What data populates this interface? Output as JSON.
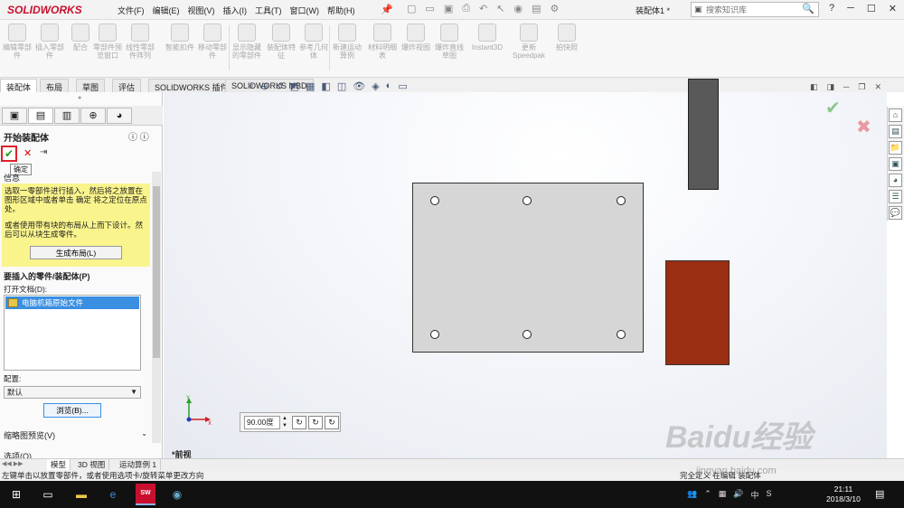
{
  "app": {
    "logo_text": "SOLIDWORKS",
    "menus": [
      "文件(F)",
      "编辑(E)",
      "视图(V)",
      "插入(I)",
      "工具(T)",
      "窗口(W)",
      "帮助(H)"
    ],
    "doc_title": "装配体1 *",
    "search_placeholder": "搜索知识库",
    "window_controls": [
      "?",
      "─",
      "☐",
      "✕"
    ]
  },
  "ribbon": {
    "items": [
      "编辑零部件",
      "插入零部件",
      "配合",
      "零部件预览窗口",
      "线性零部件阵列",
      "智能扣件",
      "移动零部件",
      "显示隐藏的零部件",
      "装配体特征",
      "参考几何体",
      "新建运动算例",
      "材料明细表",
      "爆炸视图",
      "爆炸直线草图",
      "Instant3D",
      "更新Speedpak",
      "拍快照"
    ]
  },
  "tabs": [
    "装配体",
    "布局",
    "草图",
    "评估",
    "SOLIDWORKS 插件",
    "SOLIDWORKS MBD"
  ],
  "panel": {
    "title": "开始装配体",
    "tooltip": "确定",
    "info_header": "信息",
    "info_text1": "选取一零部件进行插入，然后将之放置在图形区域中或者单击 确定 将之定位在原点处。",
    "info_text2": "或者使用带有块的布局从上而下设计。然后可以从块生成零件。",
    "layout_button": "生成布局(L)",
    "parts_header": "要插入的零件/装配体(P)",
    "open_docs_label": "打开文档(D):",
    "doc_item": "电脑机箱原始文件",
    "config_label": "配置:",
    "config_value": "默认",
    "browse_button": "浏览(B)...",
    "preview_header": "缩略图预览(V)",
    "options_header": "选项(O)"
  },
  "viewport": {
    "angle": "90.00度",
    "view_label": "*前视"
  },
  "bottom_tabs": [
    "模型",
    "3D 视图",
    "运动算例 1"
  ],
  "status": {
    "text": "左键单击以放置零部件，或者使用选项卡/旋转菜单更改方向",
    "right": "完全定义  在编辑 装配体"
  },
  "watermark": {
    "text": "Baidu经验",
    "url": "jingyan.baidu.com"
  },
  "taskbar": {
    "sw_label": "SW 2016",
    "tray_lang": "中",
    "time": "21:11",
    "date": "2018/3/10"
  },
  "colors": {
    "plate": "#d6d6d6",
    "red_block": "#9a2e12",
    "dark_bar": "#595959",
    "info_bg": "#f9f48c",
    "confirm_highlight": "#e0202a"
  }
}
